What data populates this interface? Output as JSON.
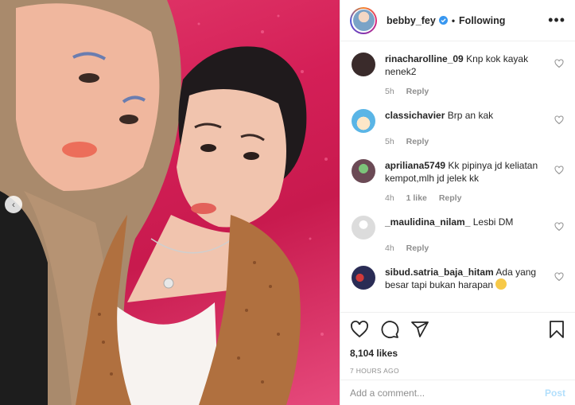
{
  "header": {
    "username": "bebby_fey",
    "separator": "•",
    "follow_state": "Following",
    "more_label": "•••"
  },
  "comments": [
    {
      "user": "rinacharolline_09",
      "text": "Knp kok kayak nenek2",
      "time": "5h",
      "likes": "",
      "reply": "Reply",
      "avatar_color": "#3a2b2b"
    },
    {
      "user": "classichavier",
      "text": "Brp an kak",
      "time": "5h",
      "likes": "",
      "reply": "Reply",
      "avatar_color": "#7ec6e8"
    },
    {
      "user": "apriliana5749",
      "text": "Kk pipinya jd keliatan kempot,mlh jd jelek kk",
      "time": "4h",
      "likes": "1 like",
      "reply": "Reply",
      "avatar_color": "#6b4a55"
    },
    {
      "user": "_maulidina_nilam_",
      "text": "Lesbi DM",
      "time": "4h",
      "likes": "",
      "reply": "Reply",
      "avatar_color": "#dcdcdc"
    },
    {
      "user": "sibud.satria_baja_hitam",
      "text": "Ada yang besar tapi bukan harapan",
      "time": "",
      "likes": "",
      "reply": "",
      "avatar_color": "#2a2c55"
    }
  ],
  "stats": {
    "likes": "8,104 likes",
    "time": "7 HOURS AGO"
  },
  "add_comment": {
    "placeholder": "Add a comment...",
    "post_label": "Post"
  },
  "carousel": {
    "prev_label": "‹"
  },
  "icons": [
    "verified-badge-icon",
    "heart-icon",
    "comment-icon",
    "share-icon",
    "bookmark-icon",
    "more-icon",
    "chevron-left-icon"
  ],
  "colors": {
    "brand_blue": "#3897f0",
    "muted": "#8e8e8e",
    "post_disabled": "#b2dffc",
    "backdrop": "#d41f57"
  }
}
